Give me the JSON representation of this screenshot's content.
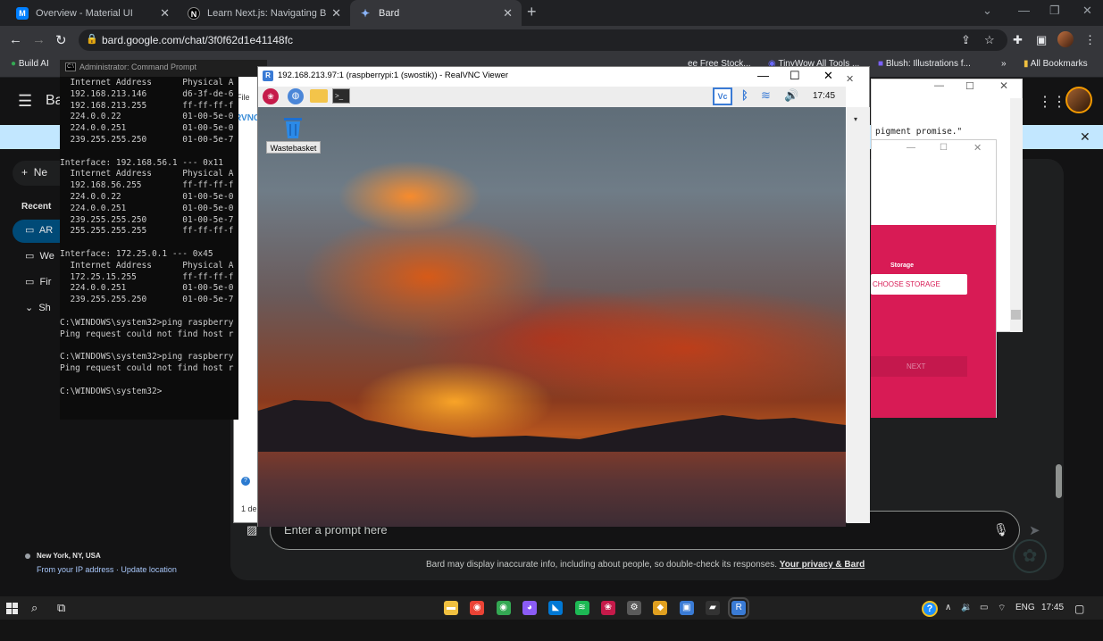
{
  "chrome": {
    "tabs": [
      {
        "title": "Overview - Material UI",
        "icon": "material-ui-icon",
        "color": "#007fff"
      },
      {
        "title": "Learn Next.js: Navigating Betwe",
        "icon": "nextjs-icon",
        "color": "#000000"
      },
      {
        "title": "Bard",
        "icon": "bard-icon",
        "color": "#8ab4f8"
      }
    ],
    "new_tab": "+",
    "url": "bard.google.com/chat/3f0f62d1e41148fc",
    "bookmarks": [
      "Build AI",
      "ee Free Stock...",
      "TinyWow All Tools ...",
      "Blush: Illustrations f...",
      "»",
      "All Bookmarks"
    ]
  },
  "bard": {
    "logo": "Ba",
    "new_chat": "Ne",
    "recent_label": "Recent",
    "recent_items": [
      "AR",
      "We",
      "Fir"
    ],
    "show_more": "Sh",
    "location_name": "New York, NY, USA",
    "location_sub": "From your IP address · Update location",
    "prompt_placeholder": "Enter a prompt here",
    "disclaimer": "Bard may display inaccurate info, including about people, so double-check its responses.",
    "disclaimer_link": "Your privacy & Bard",
    "banner_color": "#c2e7ff"
  },
  "cmd": {
    "title": "Administrator: Command Prompt",
    "lines": [
      "  Internet Address      Physical A",
      "  192.168.213.146       d6-3f-de-6",
      "  192.168.213.255       ff-ff-ff-f",
      "  224.0.0.22            01-00-5e-0",
      "  224.0.0.251           01-00-5e-0",
      "  239.255.255.250       01-00-5e-7",
      "",
      "Interface: 192.168.56.1 --- 0x11",
      "  Internet Address      Physical A",
      "  192.168.56.255        ff-ff-ff-f",
      "  224.0.0.22            01-00-5e-0",
      "  224.0.0.251           01-00-5e-0",
      "  239.255.255.250       01-00-5e-7",
      "  255.255.255.255       ff-ff-ff-f",
      "",
      "Interface: 172.25.0.1 --- 0x45",
      "  Internet Address      Physical A",
      "  172.25.15.255         ff-ff-ff-f",
      "  224.0.0.251           01-00-5e-0",
      "  239.255.255.250       01-00-5e-7",
      "",
      "C:\\WINDOWS\\system32>ping raspberry",
      "Ping request could not find host r",
      "",
      "C:\\WINDOWS\\system32>ping raspberry",
      "Ping request could not find host r",
      "",
      "C:\\WINDOWS\\system32>"
    ]
  },
  "bg_browser": {
    "menu": "File",
    "vnc_label": "RVNC",
    "status": "1 de"
  },
  "back_dialog": {
    "quote": "pigment promise.\""
  },
  "app_window": {
    "storage_label": "Storage",
    "choose_storage": "CHOOSE STORAGE",
    "next": "NEXT",
    "accent": "#d81b55"
  },
  "vnc": {
    "title": "192.168.213.97:1 (raspberrypi:1 (swostik)) - RealVNC Viewer",
    "clock": "17:45",
    "desktop_icon_label": "Wastebasket"
  },
  "taskbar": {
    "apps": [
      {
        "icon": "file-explorer-icon",
        "color": "#f0c040"
      },
      {
        "icon": "chrome-icon",
        "color": "#ea4335"
      },
      {
        "icon": "chrome-profile-icon",
        "color": "#34a853"
      },
      {
        "icon": "github-icon",
        "color": "#8b5cf6"
      },
      {
        "icon": "vscode-icon",
        "color": "#0078d4"
      },
      {
        "icon": "spotify-icon",
        "color": "#1db954"
      },
      {
        "icon": "raspberry-imager-icon",
        "color": "#c51a4a"
      },
      {
        "icon": "settings-icon",
        "color": "#5a5a5a"
      },
      {
        "icon": "app-icon",
        "color": "#e0a020"
      },
      {
        "icon": "remote-desktop-icon",
        "color": "#3a7bd5"
      },
      {
        "icon": "terminal-icon",
        "color": "#333333"
      },
      {
        "icon": "realvnc-icon",
        "color": "#3a7bd5"
      }
    ],
    "language": "ENG",
    "time": "17:45"
  }
}
